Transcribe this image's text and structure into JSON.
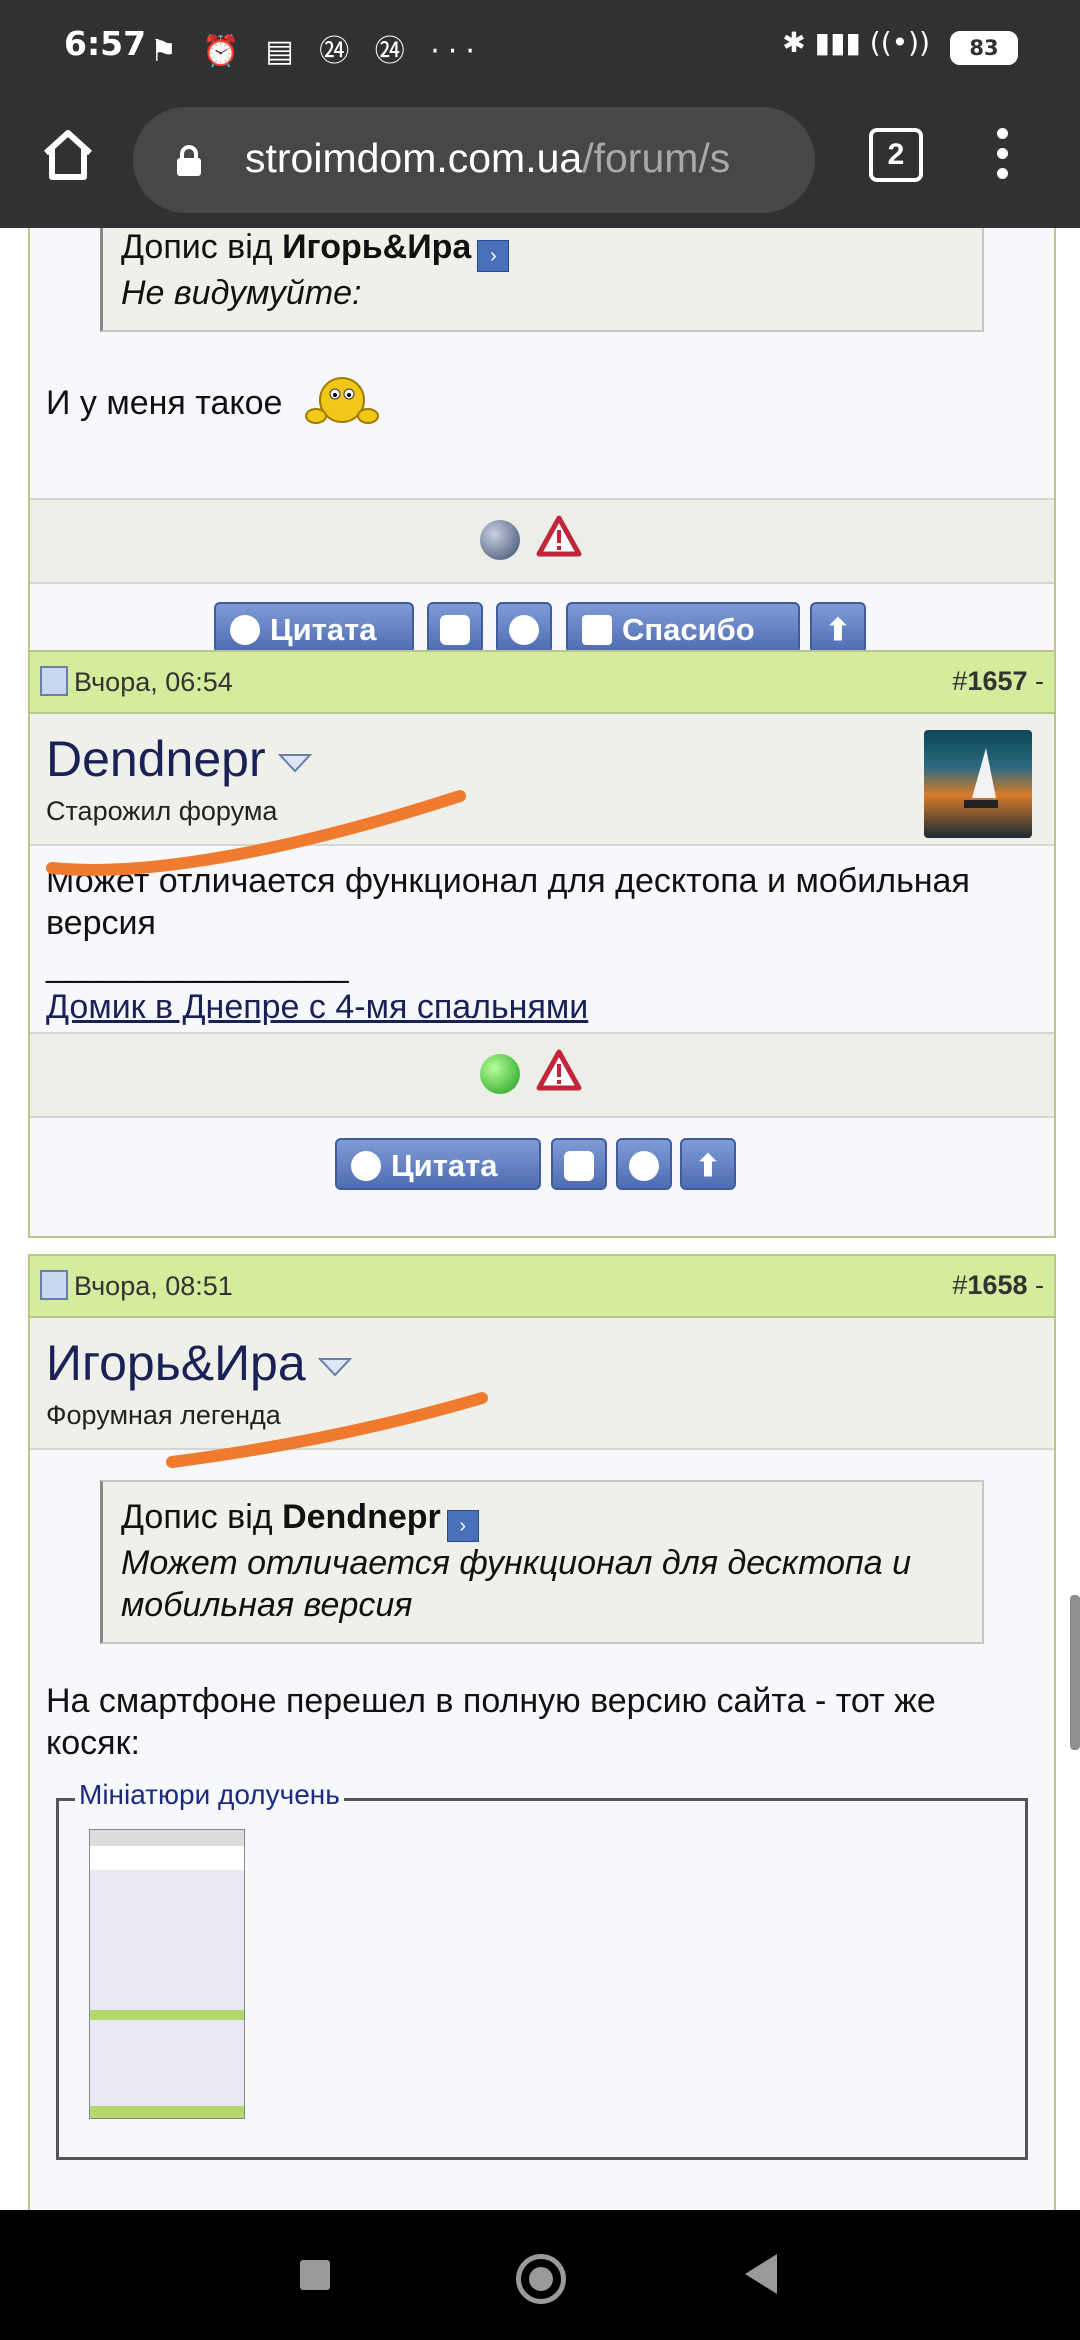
{
  "status_bar": {
    "time": "6:57",
    "icons": "⚑ ⏰ ▤ ㉔ ㉔ ···",
    "right_icons": "✱ ▮▮▮ ((•))",
    "battery": "83"
  },
  "browser": {
    "url_domain": "stroimdom.com.ua",
    "url_path": "/forum/s",
    "tab_count": "2"
  },
  "post0": {
    "quote_by_prefix": "Допис від ",
    "quote_by_user": "Игорь&Ира",
    "quote_text": "Не видумуйте:",
    "body": "И у меня такое",
    "buttons": {
      "quote": "Цитата",
      "thanks": "Спасибо"
    }
  },
  "post1": {
    "date": "Вчора, 06:54",
    "number_prefix": "#",
    "number": "1657",
    "number_suffix": " -",
    "username": "Dendnepr",
    "user_title": "Старожил форума",
    "body": "Может отличается функционал для десктопа и мобильная версия",
    "sig_rule": "________________",
    "sig_link": "Домик в Днепре с 4-мя спальнями",
    "buttons": {
      "quote": "Цитата"
    }
  },
  "post2": {
    "date": "Вчора, 08:51",
    "number_prefix": "#",
    "number": "1658",
    "number_suffix": " -",
    "username": "Игорь&Ира",
    "user_title": "Форумная легенда",
    "quote_by_prefix": "Допис від ",
    "quote_by_user": "Dendnepr",
    "quote_text": "Может отличается функционал для десктопа и мобильная версия",
    "body": "На смартфоне перешел в полную версию сайта - тот же косяк:",
    "attachments_legend": "Мініатюри долучень"
  },
  "colors": {
    "post_header": "#d4ec9c",
    "username": "#1a2157",
    "button": "#4e6cb2",
    "annotation_stroke": "#f07a2e"
  }
}
